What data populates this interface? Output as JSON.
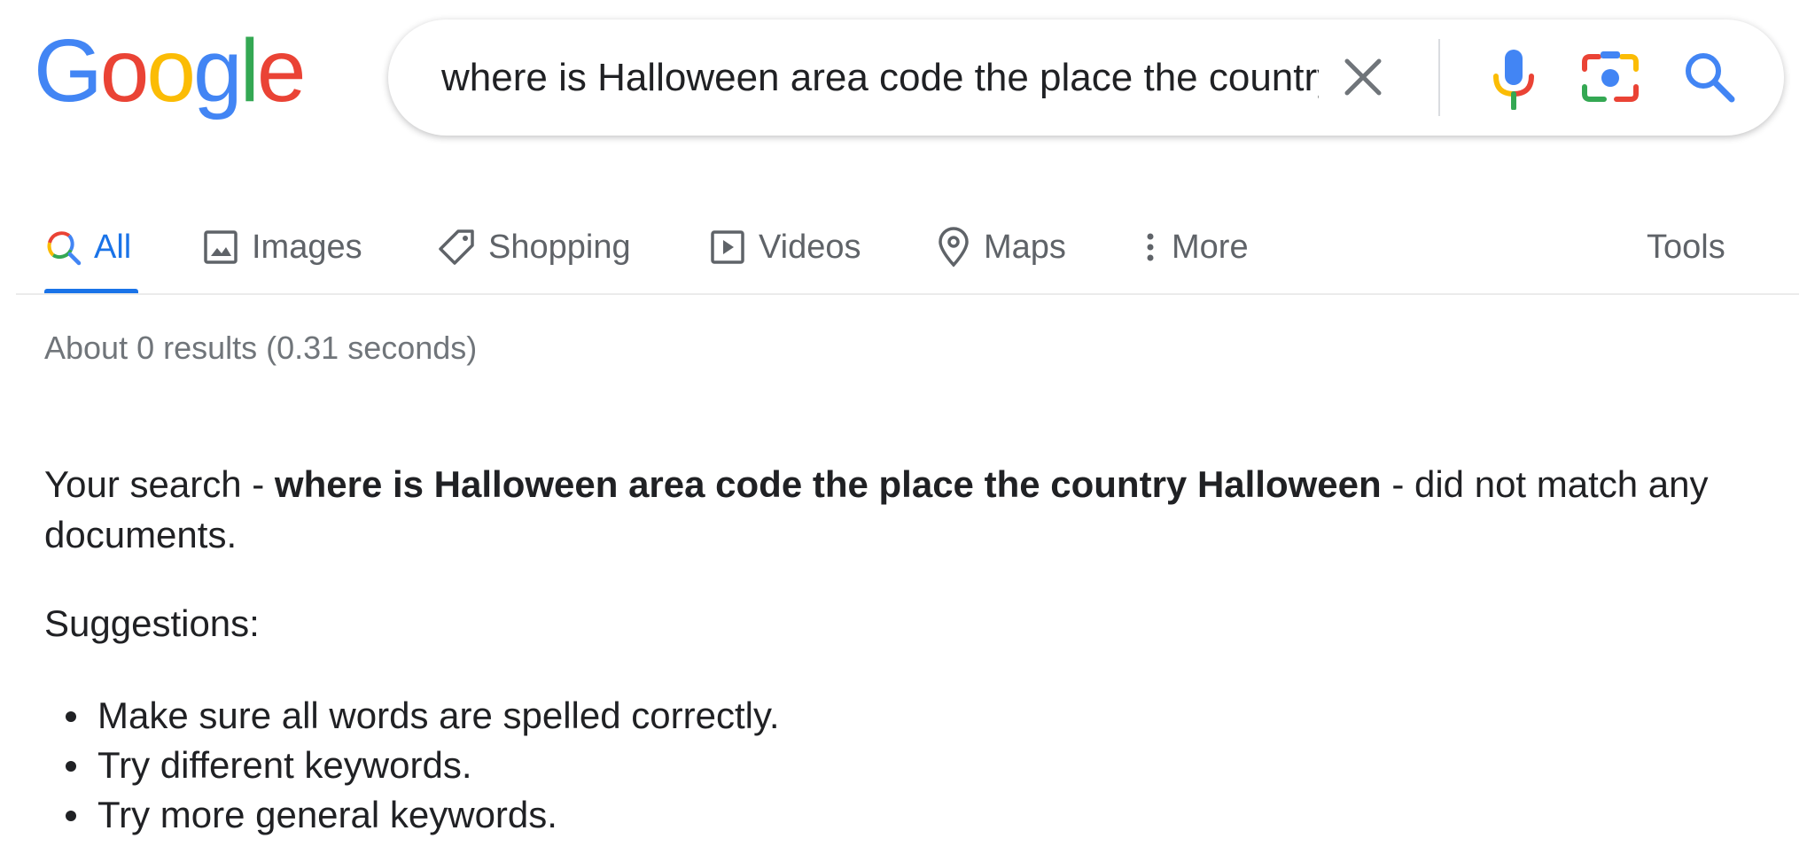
{
  "logo": {
    "letters": [
      "G",
      "o",
      "o",
      "g",
      "l",
      "e"
    ],
    "colors": [
      "#4285F4",
      "#EA4335",
      "#FBBC05",
      "#4285F4",
      "#34A853",
      "#EA4335"
    ]
  },
  "search": {
    "value": "where is Halloween area code the place the country Halloween"
  },
  "tabs": [
    {
      "label": "All",
      "icon": "search-icon",
      "active": true
    },
    {
      "label": "Images",
      "icon": "image-icon"
    },
    {
      "label": "Shopping",
      "icon": "tag-icon"
    },
    {
      "label": "Videos",
      "icon": "play-icon"
    },
    {
      "label": "Maps",
      "icon": "map-pin-icon"
    },
    {
      "label": "More",
      "icon": "more-vert-icon"
    }
  ],
  "tools_label": "Tools",
  "result_stats": "About 0 results (0.31 seconds)",
  "message": {
    "prefix": "Your search - ",
    "query": "where is Halloween area code the place the country Halloween",
    "suffix": " - did not match any documents."
  },
  "suggestions_label": "Suggestions:",
  "suggestions": [
    "Make sure all words are spelled correctly.",
    "Try different keywords.",
    "Try more general keywords."
  ],
  "colors": {
    "accent": "#1a73e8",
    "muted": "#5f6368",
    "text": "#202124"
  }
}
